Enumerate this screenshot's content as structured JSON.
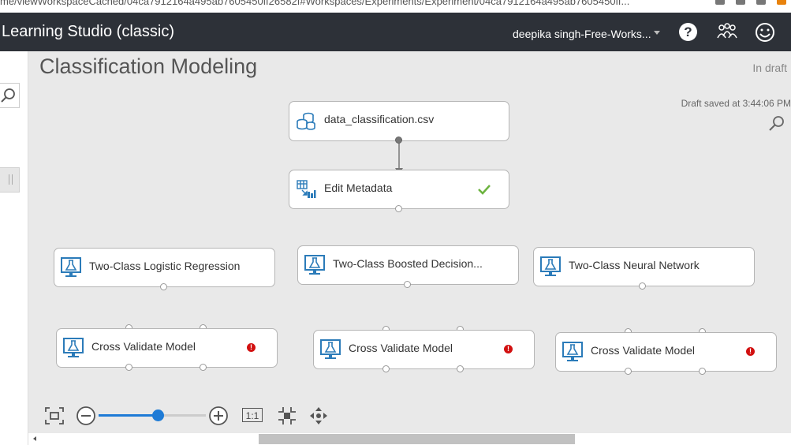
{
  "browser": {
    "url": "me/viewWorkspaceCached/04ca7912164a495ab7605450ff26582f#Workspaces/Experiments/Experiment/04ca7912164a495ab7605450ff..."
  },
  "appbar": {
    "title": "Learning Studio (classic)",
    "workspace": "deepika singh-Free-Works...",
    "help_label": "?"
  },
  "experiment": {
    "title": "Classification Modeling",
    "status": "In draft",
    "saved": "Draft saved at 3:44:06 PM"
  },
  "modules": {
    "dataset": {
      "label": "data_classification.csv",
      "icon": "dataset-icon"
    },
    "edit_metadata": {
      "label": "Edit Metadata",
      "icon": "edit-metadata-icon",
      "state": "completed"
    },
    "logistic": {
      "label": "Two-Class Logistic Regression",
      "icon": "flask-monitor-icon"
    },
    "boosted": {
      "label": "Two-Class Boosted Decision...",
      "icon": "flask-monitor-icon"
    },
    "neural": {
      "label": "Two-Class Neural Network",
      "icon": "flask-monitor-icon"
    },
    "cv1": {
      "label": "Cross Validate Model",
      "icon": "flask-monitor-icon",
      "state": "error",
      "badge": "!"
    },
    "cv2": {
      "label": "Cross Validate Model",
      "icon": "flask-monitor-icon",
      "state": "error",
      "badge": "!"
    },
    "cv3": {
      "label": "Cross Validate Model",
      "icon": "flask-monitor-icon",
      "state": "error",
      "badge": "!"
    }
  },
  "toolbar": {
    "actual_size_label": "1:1",
    "zoom_fraction": 0.55
  },
  "colors": {
    "appbar": "#2d3138",
    "accent": "#1e7bd6",
    "error": "#d21010",
    "success": "#6cb33f",
    "module_icon": "#2b7bb9"
  }
}
